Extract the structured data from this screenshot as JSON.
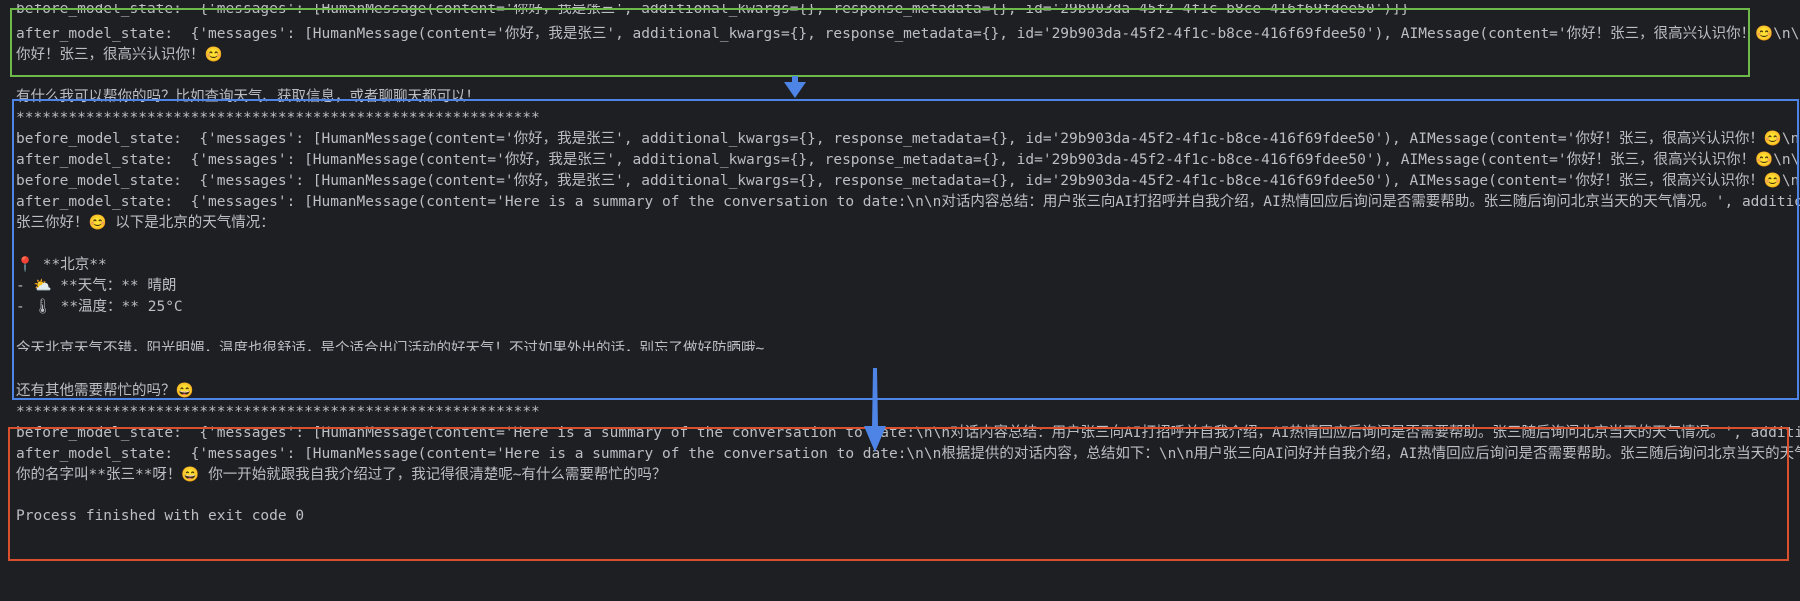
{
  "console": {
    "lines": [
      "before_model_state:  {'messages': [HumanMessage(content='你好，我是张三', additional_kwargs={}, response_metadata={}, id='29b903da-45f2-4f1c-b8ce-416f69fdee50')]}",
      "after_model_state:  {'messages': [HumanMessage(content='你好，我是张三', additional_kwargs={}, response_metadata={}, id='29b903da-45f2-4f1c-b8ce-416f69fdee50'), AIMessage(content='你好！张三，很高兴认识你！😊\\n\\n有什么我可以帮你的",
      "你好！张三，很高兴认识你！😊",
      "有什么我可以帮你的吗？比如查询天气、获取信息，或者聊聊天都可以！",
      "************************************************************",
      "before_model_state:  {'messages': [HumanMessage(content='你好，我是张三', additional_kwargs={}, response_metadata={}, id='29b903da-45f2-4f1c-b8ce-416f69fdee50'), AIMessage(content='你好！张三，很高兴认识你！😊\\n\\n有什么我可以帮你的",
      "after_model_state:  {'messages': [HumanMessage(content='你好，我是张三', additional_kwargs={}, response_metadata={}, id='29b903da-45f2-4f1c-b8ce-416f69fdee50'), AIMessage(content='你好！张三，很高兴认识你！😊\\n\\n有什么我可以帮你的",
      "before_model_state:  {'messages': [HumanMessage(content='你好，我是张三', additional_kwargs={}, response_metadata={}, id='29b903da-45f2-4f1c-b8ce-416f69fdee50'), AIMessage(content='你好！张三，很高兴认识你！😊\\n\\n有什么我可以帮你的",
      "after_model_state:  {'messages': [HumanMessage(content='Here is a summary of the conversation to date:\\n\\n对话内容总结：用户张三向AI打招呼并自我介绍，AI热情回应后询问是否需要帮助。张三随后询问北京当天的天气情况。', additional_kwargs={'l",
      "张三你好！😊 以下是北京的天气情况：",
      "📍 **北京**",
      "- ⛅ **天气：** 晴朗",
      "- 🌡 **温度：** 25°C",
      "今天北京天气不错，阳光明媚，温度也很舒适，是个适合出门活动的好天气！不过如果外出的话，别忘了做好防晒哦~",
      "还有其他需要帮忙的吗？😄",
      "************************************************************",
      "before_model_state:  {'messages': [HumanMessage(content='Here is a summary of the conversation to date:\\n\\n对话内容总结：用户张三向AI打招呼并自我介绍，AI热情回应后询问是否需要帮助。张三随后询问北京当天的天气情况。', additional_kwargs={'",
      "after_model_state:  {'messages': [HumanMessage(content='Here is a summary of the conversation to date:\\n\\n根据提供的对话内容，总结如下：\\n\\n用户张三向AI问好并自我介绍，AI热情回应后询问是否需要帮助。张三随后询问北京当天的天气，AI调用天气工具",
      "你的名字叫**张三**呀！😄 你一开始就跟我自我介绍过了，我记得很清楚呢~有什么需要帮忙的吗？",
      "Process finished with exit code 0"
    ]
  },
  "annotations": {
    "colors": {
      "green": "#6dba4a",
      "blue": "#4d84e6",
      "orange": "#d9502f",
      "arrow": "#4d84e6",
      "background": "#1e1f22",
      "text": "#bcbec4"
    }
  }
}
